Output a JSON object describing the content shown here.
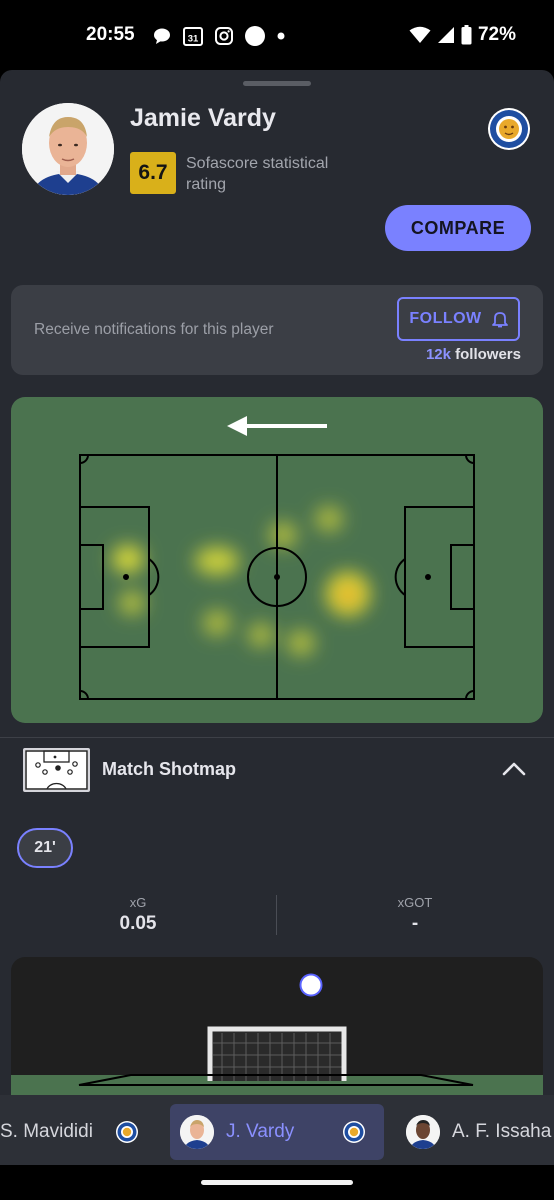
{
  "status": {
    "time": "20:55",
    "battery": "72%",
    "calendar_day": "31"
  },
  "player": {
    "name": "Jamie Vardy",
    "rating": "6.7",
    "rating_label": "Sofascore statistical rating",
    "compare_label": "COMPARE",
    "club_logo_icon": "leicester-city-crest-icon"
  },
  "follow": {
    "prompt": "Receive notifications for this player",
    "button_label": "FOLLOW",
    "followers_count": "12k",
    "followers_word": "followers"
  },
  "heatmap": {
    "attack_direction": "left",
    "pitch_color": "#4b734f"
  },
  "shotmap": {
    "title": "Match Shotmap",
    "minute": "21'",
    "xg_label": "xG",
    "xg_value": "0.05",
    "xgot_label": "xGOT",
    "xgot_value": "-"
  },
  "player_bar": {
    "items": [
      {
        "label": "S. Mavididi",
        "active": false
      },
      {
        "label": "J. Vardy",
        "active": true
      },
      {
        "label": "A. F. Issaha",
        "active": false
      }
    ]
  },
  "colors": {
    "accent": "#7a81ff",
    "rating": "#d9b01a",
    "background": "#272a31"
  }
}
